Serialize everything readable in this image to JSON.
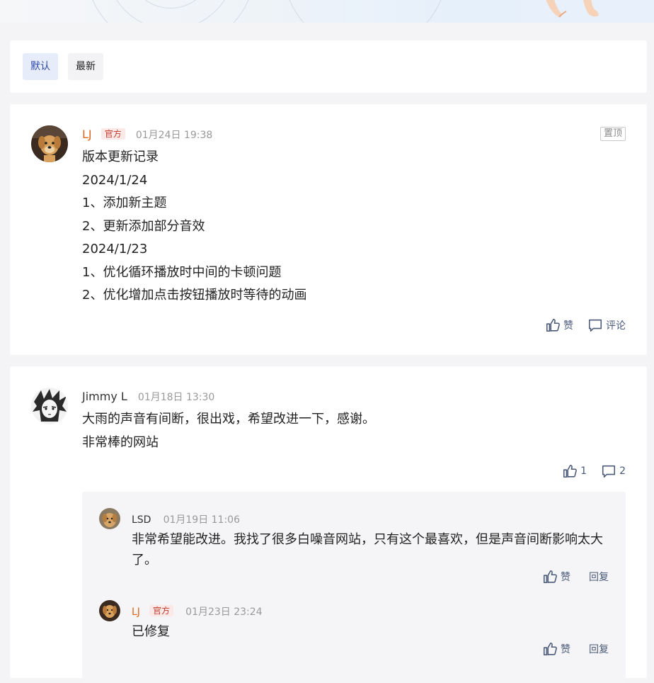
{
  "tabs": [
    {
      "label": "默认",
      "active": true
    },
    {
      "label": "最新",
      "active": false
    }
  ],
  "posts": [
    {
      "author": "LJ",
      "badge": "官方",
      "time": "01月24日 19:38",
      "pinned_label": "置顶",
      "lines": [
        "版本更新记录",
        "2024/1/24",
        "1、添加新主题",
        "2、更新添加部分音效",
        "2024/1/23",
        "1、优化循环播放时中间的卡顿问题",
        "2、优化增加点击按钮播放时等待的动画"
      ],
      "like_label": "赞",
      "comment_label": "评论"
    },
    {
      "author": "Jimmy L",
      "time": "01月18日 13:30",
      "lines": [
        "大雨的声音有间断，很出戏，希望改进一下，感谢。",
        "非常棒的网站"
      ],
      "like_count": "1",
      "comment_count": "2",
      "replies": [
        {
          "author": "LSD",
          "time": "01月19日 11:06",
          "text": "非常希望能改进。我找了很多白噪音网站，只有这个最喜欢，但是声音间断影响太大了。",
          "like_label": "赞",
          "reply_label": "回复"
        },
        {
          "author": "LJ",
          "badge": "官方",
          "time": "01月23日 23:24",
          "text": "已修复",
          "like_label": "赞",
          "reply_label": "回复"
        }
      ]
    }
  ],
  "colors": {
    "official_name": "#e0651a",
    "active_tab_bg": "#e7ecfb",
    "active_tab_text": "#2e4aa8",
    "action_icon": "#4a5a78"
  },
  "icons": [
    "thumb-up-icon",
    "comment-icon"
  ]
}
